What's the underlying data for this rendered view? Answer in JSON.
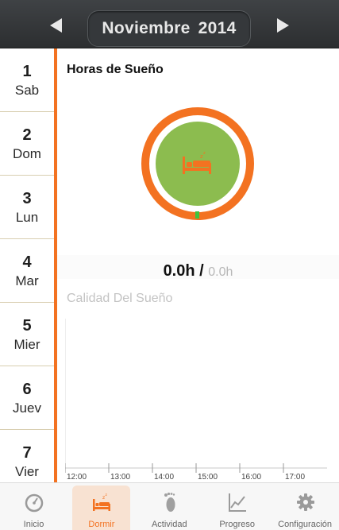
{
  "header": {
    "month": "Noviembre",
    "year": "2014"
  },
  "days": [
    {
      "num": "1",
      "name": "Sab"
    },
    {
      "num": "2",
      "name": "Dom"
    },
    {
      "num": "3",
      "name": "Lun"
    },
    {
      "num": "4",
      "name": "Mar"
    },
    {
      "num": "5",
      "name": "Mier"
    },
    {
      "num": "6",
      "name": "Juev"
    },
    {
      "num": "7",
      "name": "Vier"
    }
  ],
  "sleep": {
    "title": "Horas de Sueño",
    "current": "0.0h",
    "separator": "/",
    "goal": "0.0h",
    "progress_fraction": 0.0
  },
  "quality": {
    "label": "Calidad Del Sueño",
    "time_ticks": [
      "12:00",
      "13:00",
      "14:00",
      "15:00",
      "16:00",
      "17:00"
    ]
  },
  "tabs": [
    {
      "label": "Inicio",
      "icon": "speedometer-icon"
    },
    {
      "label": "Dormir",
      "icon": "bed-icon"
    },
    {
      "label": "Actividad",
      "icon": "footprint-icon"
    },
    {
      "label": "Progreso",
      "icon": "chart-icon"
    },
    {
      "label": "Configuración",
      "icon": "gear-icon"
    }
  ],
  "colors": {
    "accent": "#f37221",
    "ring_fill": "#8cbc4f",
    "progress_marker": "#3ec43e",
    "header_bg": "#35383b"
  }
}
